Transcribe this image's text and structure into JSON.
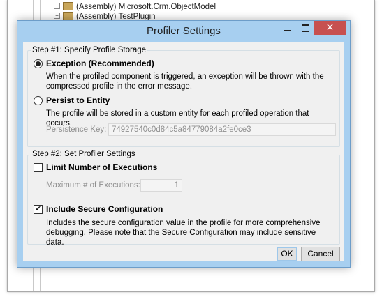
{
  "background_tree": {
    "rows": [
      {
        "expander": "+",
        "label": "(Assembly) Microsoft.Crm.ObjectModel"
      },
      {
        "expander": "−",
        "label": "(Assembly) TestPlugin"
      }
    ]
  },
  "dialog": {
    "title": "Profiler Settings",
    "titlebar_controls": {
      "minimize": "minimize",
      "maximize": "maximize",
      "close": "✕"
    },
    "step1": {
      "legend": "Step #1: Specify Profile Storage",
      "option_exception": {
        "label": "Exception (Recommended)",
        "selected": true,
        "description": "When the profiled component is triggered, an exception will be thrown with the compressed profile in the error message."
      },
      "option_entity": {
        "label": "Persist to Entity",
        "selected": false,
        "description": "The profile will be stored in a custom entity for each profiled operation that occurs."
      },
      "persistence_key_label": "Persistence Key:",
      "persistence_key_value": "74927540c0d84c5a84779084a2fe0ce3"
    },
    "step2": {
      "legend": "Step #2: Set Profiler Settings",
      "limit_executions": {
        "label": "Limit Number of Executions",
        "checked": false
      },
      "max_executions_label": "Maximum # of Executions:",
      "max_executions_value": "1",
      "secure_config": {
        "label": "Include Secure Configuration",
        "checked": true,
        "check_glyph": "✔",
        "description": "Includes the secure configuration value in the profile for more comprehensive debugging. Please note that the Secure Configuration may include sensitive data."
      }
    },
    "buttons": {
      "ok": "OK",
      "cancel": "Cancel"
    }
  }
}
